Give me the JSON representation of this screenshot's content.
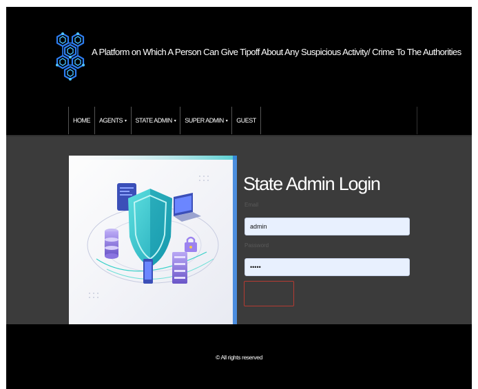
{
  "header": {
    "site_title": "A Platform on Which A Person Can Give Tipoff About Any Suspicious Activity/ Crime To The Authorities",
    "logo_icon": "hexagon-network-icon"
  },
  "nav": {
    "items": [
      {
        "label": "HOME",
        "has_caret": false
      },
      {
        "label": "AGENTS",
        "has_caret": true
      },
      {
        "label": "STATE ADMIN",
        "has_caret": true
      },
      {
        "label": "SUPER ADMIN",
        "has_caret": true
      },
      {
        "label": "GUEST",
        "has_caret": false
      }
    ],
    "caret": "▾"
  },
  "login": {
    "title": "State Admin Login",
    "email_label": "Email",
    "email_value": "admin",
    "password_label": "Password",
    "password_value": "•••••",
    "submit_label": ""
  },
  "footer": {
    "text": "© All rights reserved"
  },
  "colors": {
    "header_bg": "#000000",
    "main_bg": "#3b3b3b",
    "input_bg": "#e8f0fe",
    "button_border": "#b63b32",
    "illustration_accent": "#2fc7c7"
  }
}
